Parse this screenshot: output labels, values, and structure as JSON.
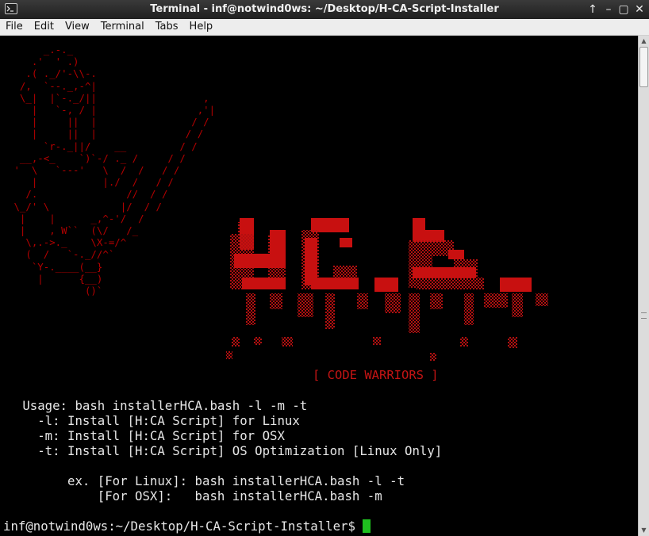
{
  "window": {
    "title": "Terminal - inf@notwind0ws: ~/Desktop/H-CA-Script-Installer",
    "controls": [
      "↑",
      "–",
      "▢",
      "✕"
    ]
  },
  "menu": [
    "File",
    "Edit",
    "View",
    "Terminal",
    "Tabs",
    "Help"
  ],
  "ascii_art": "      _.-._\n    .'  ' .)\n   .( ._/'-\\\\-.\n  /,  `--._,-^|\n  \\_|  |`-._/||                  ,\n    |   `-, / |                 ,'|\n    |     ||  |                / /\n    |     ||  |               / /\n      `r-._||/    __         / /\n  __,-<_    `)`-/ ._ /     / /\n '  \\   `---'   \\  /  /   / /\n    |           |./  /   / /\n   /.               //  / /\n \\_/' \\            |/  / /\n  |    |      _,^-'/  /\n  |    , W``  (\\/   /_\n   \\,.->._    \\X-=/^\n   (  /   `-._//^`\n    `Y-.____(__}\n     |      {__)\n             ()`",
  "logo": {
    "text": "HCA",
    "color": "#c81010"
  },
  "tagline": "[ CODE WARRIORS ]",
  "usage_lines": [
    "   Usage: bash installerHCA.bash -l -m -t",
    "     -l: Install [H:CA Script] for Linux",
    "     -m: Install [H:CA Script] for OSX",
    "     -t: Install [H:CA Script] OS Optimization [Linux Only]",
    "",
    "         ex. [For Linux]: bash installerHCA.bash -l -t",
    "             [For OSX]:   bash installerHCA.bash -m"
  ],
  "prompt": "inf@notwind0ws:~/Desktop/H-CA-Script-Installer$",
  "cursor_color": "#1fbf1f"
}
